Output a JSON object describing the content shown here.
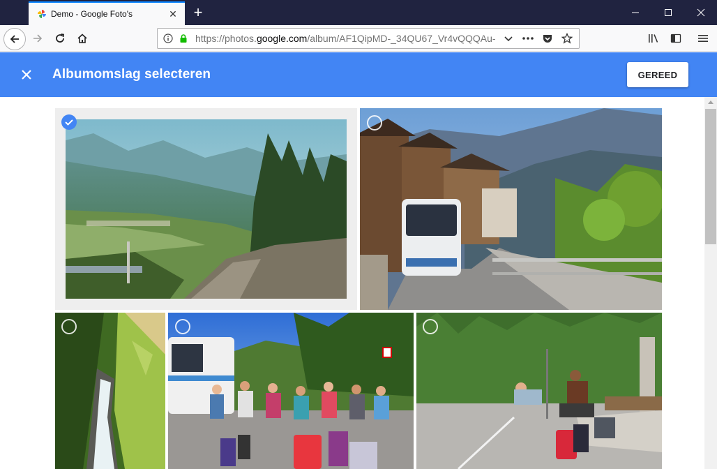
{
  "browser": {
    "tab_title": "Demo - Google Foto's",
    "url_prefix": "https://photos.",
    "url_domain": "google.com",
    "url_path": "/album/AF1QipMD-_34QU67_Vr4vQQQAu-"
  },
  "header": {
    "title": "Albumomslag selecteren",
    "done_label": "GEREED"
  },
  "photos": [
    {
      "label": "photo-valley-trail",
      "selected": true
    },
    {
      "label": "photo-bus-village",
      "selected": false
    },
    {
      "label": "photo-waterfall",
      "selected": false
    },
    {
      "label": "photo-group-luggage",
      "selected": false
    },
    {
      "label": "photo-parking-rest",
      "selected": false
    }
  ],
  "colors": {
    "accent": "#4285f4",
    "tabbar": "#202340"
  }
}
